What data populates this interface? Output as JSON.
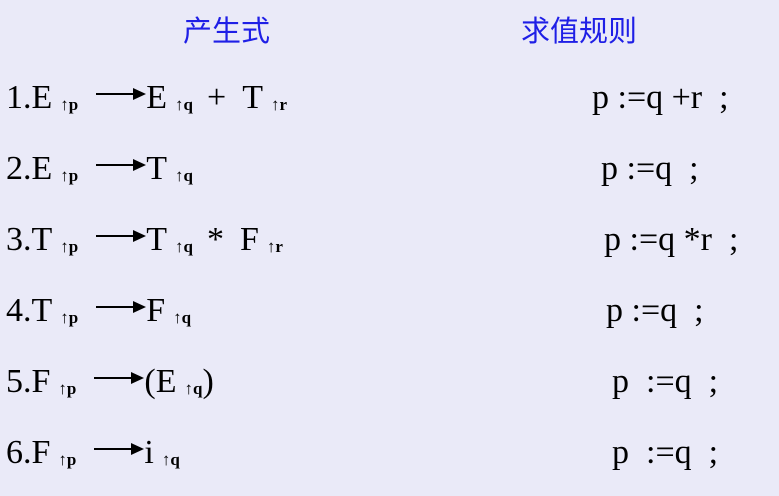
{
  "headers": {
    "production": "产生式",
    "evaluation_rule": "求值规则"
  },
  "rows": [
    {
      "prefix": "1.E",
      "lhs_sub": "↑p",
      "rhs1": "E",
      "rhs1_sub": "↑q",
      "op": "+",
      "rhs2": "T",
      "rhs2_sub": "↑r",
      "rule": "p :=q +r  ;"
    },
    {
      "prefix": "2.E",
      "lhs_sub": "↑p",
      "rhs1": "T",
      "rhs1_sub": "↑q",
      "rule": "p :=q  ;"
    },
    {
      "prefix": "3.T",
      "lhs_sub": "↑p",
      "rhs1": "T",
      "rhs1_sub": "↑q",
      "op": "*",
      "rhs2": "F",
      "rhs2_sub": "↑r",
      "rule": "p :=q *r  ;"
    },
    {
      "prefix": "4.T",
      "lhs_sub": "↑p",
      "rhs1": "F",
      "rhs1_sub": "↑q",
      "rule": "p :=q  ;"
    },
    {
      "prefix": "5.F",
      "lhs_sub": "↑p",
      "rhs1": "(E",
      "rhs1_sub": "↑q",
      "rhs_tail": ")",
      "rule": "p  :=q  ;"
    },
    {
      "prefix": "6.F",
      "lhs_sub": "↑p",
      "rhs1": "i",
      "rhs1_sub": "↑q",
      "rule": "p  :=q  ;"
    }
  ],
  "colors": {
    "background": "#eaeaf8",
    "header_text": "#1f1fe6",
    "body_text": "#000000"
  },
  "icons": {
    "production_arrow": "right-arrow-icon"
  }
}
